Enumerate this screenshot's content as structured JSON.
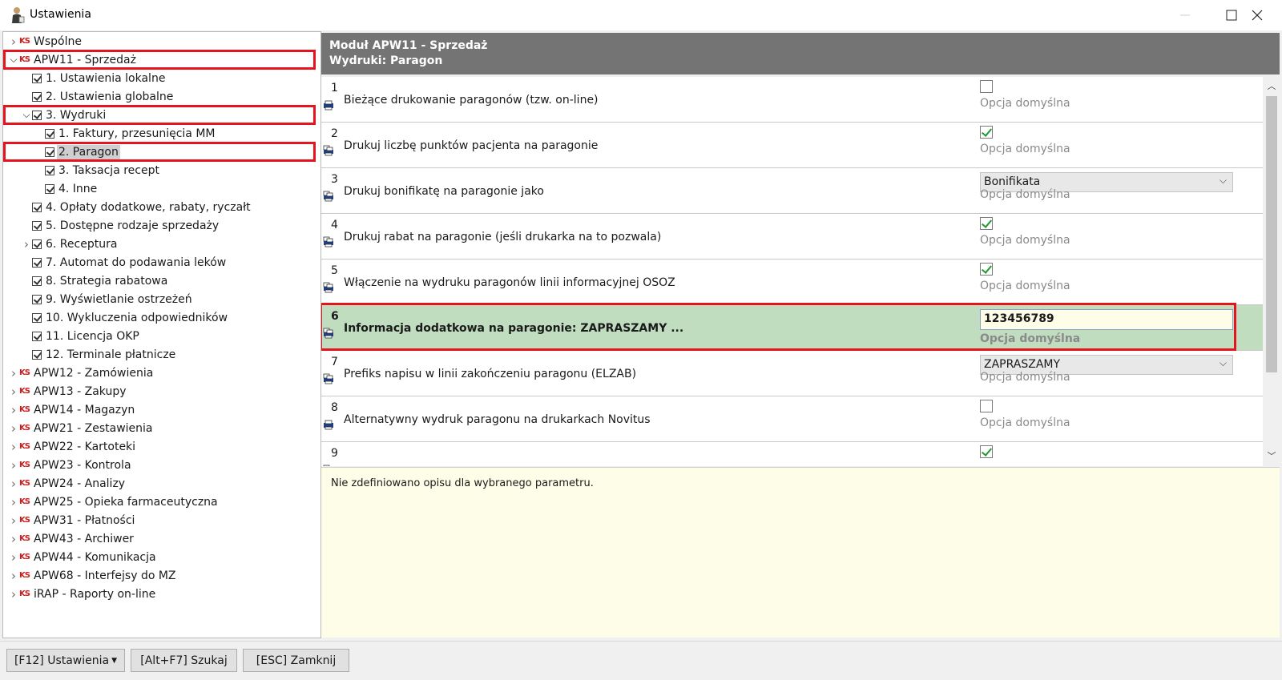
{
  "window": {
    "title": "Ustawienia"
  },
  "tree": [
    {
      "label": "Wspólne",
      "level": 0,
      "icon": "ks-icon",
      "expander": "chevron-right-icon"
    },
    {
      "label": "APW11 - Sprzedaż",
      "level": 0,
      "icon": "ks-icon",
      "expander": "chevron-down-icon",
      "highlight": true
    },
    {
      "label": "1. Ustawienia lokalne",
      "level": 1,
      "icon": "check-icon"
    },
    {
      "label": "2. Ustawienia globalne",
      "level": 1,
      "icon": "check-icon"
    },
    {
      "label": "3. Wydruki",
      "level": 1,
      "icon": "check-icon",
      "expander": "chevron-down-icon",
      "highlight": true
    },
    {
      "label": "1. Faktury, przesunięcia MM",
      "level": 2,
      "icon": "check-icon"
    },
    {
      "label": "2. Paragon",
      "level": 2,
      "icon": "check-icon",
      "selected": true,
      "highlight": true
    },
    {
      "label": "3. Taksacja recept",
      "level": 2,
      "icon": "check-icon"
    },
    {
      "label": "4. Inne",
      "level": 2,
      "icon": "check-icon"
    },
    {
      "label": "4. Opłaty dodatkowe, rabaty, ryczałt",
      "level": 1,
      "icon": "check-icon"
    },
    {
      "label": "5. Dostępne rodzaje sprzedaży",
      "level": 1,
      "icon": "check-icon"
    },
    {
      "label": "6. Receptura",
      "level": 1,
      "icon": "check-icon",
      "expander": "chevron-right-icon"
    },
    {
      "label": "7. Automat do podawania leków",
      "level": 1,
      "icon": "check-icon"
    },
    {
      "label": "8. Strategia rabatowa",
      "level": 1,
      "icon": "check-icon"
    },
    {
      "label": "9. Wyświetlanie ostrzeżeń",
      "level": 1,
      "icon": "check-icon"
    },
    {
      "label": "10. Wykluczenia odpowiedników",
      "level": 1,
      "icon": "check-icon"
    },
    {
      "label": "11. Licencja OKP",
      "level": 1,
      "icon": "check-icon"
    },
    {
      "label": "12. Terminale płatnicze",
      "level": 1,
      "icon": "check-icon"
    },
    {
      "label": "APW12 - Zamówienia",
      "level": 0,
      "icon": "ks-icon",
      "expander": "chevron-right-icon"
    },
    {
      "label": "APW13 - Zakupy",
      "level": 0,
      "icon": "ks-icon",
      "expander": "chevron-right-icon"
    },
    {
      "label": "APW14 - Magazyn",
      "level": 0,
      "icon": "ks-icon",
      "expander": "chevron-right-icon"
    },
    {
      "label": "APW21 - Zestawienia",
      "level": 0,
      "icon": "ks-icon",
      "expander": "chevron-right-icon"
    },
    {
      "label": "APW22 - Kartoteki",
      "level": 0,
      "icon": "ks-icon",
      "expander": "chevron-right-icon"
    },
    {
      "label": "APW23 - Kontrola",
      "level": 0,
      "icon": "ks-icon",
      "expander": "chevron-right-icon"
    },
    {
      "label": "APW24 - Analizy",
      "level": 0,
      "icon": "ks-icon",
      "expander": "chevron-right-icon"
    },
    {
      "label": "APW25 - Opieka farmaceutyczna",
      "level": 0,
      "icon": "ks-icon",
      "expander": "chevron-right-icon"
    },
    {
      "label": "APW31 - Płatności",
      "level": 0,
      "icon": "ks-icon",
      "expander": "chevron-right-icon"
    },
    {
      "label": "APW43 - Archiwer",
      "level": 0,
      "icon": "ks-icon",
      "expander": "chevron-right-icon"
    },
    {
      "label": "APW44 - Komunikacja",
      "level": 0,
      "icon": "ks-icon",
      "expander": "chevron-right-icon"
    },
    {
      "label": "APW68 - Interfejsy do MZ",
      "level": 0,
      "icon": "ks-icon",
      "expander": "chevron-right-icon"
    },
    {
      "label": "iRAP - Raporty on-line",
      "level": 0,
      "icon": "ks-icon",
      "expander": "chevron-right-icon"
    }
  ],
  "header": {
    "line1": "Moduł APW11 - Sprzedaż",
    "line2": "Wydruki: Paragon"
  },
  "params": [
    {
      "num": "1",
      "name": "Bieżące drukowanie paragonów (tzw. on-line)",
      "control": "checkbox",
      "checked": false,
      "default": "Opcja domyślna",
      "icon": "printer-icon"
    },
    {
      "num": "2",
      "name": "Drukuj liczbę punktów pacjenta na paragonie",
      "control": "checkbox",
      "checked": true,
      "default": "Opcja domyślna",
      "icon": "printer-multi-icon"
    },
    {
      "num": "3",
      "name": "Drukuj bonifikatę na paragonie jako",
      "control": "select",
      "value": "Bonifikata",
      "default": "Opcja domyślna",
      "icon": "printer-multi-icon"
    },
    {
      "num": "4",
      "name": "Drukuj rabat na paragonie (jeśli drukarka na to pozwala)",
      "control": "checkbox",
      "checked": true,
      "default": "Opcja domyślna",
      "icon": "printer-multi-icon"
    },
    {
      "num": "5",
      "name": "Włączenie na wydruku paragonów linii informacyjnej OSOZ",
      "control": "checkbox",
      "checked": true,
      "default": "Opcja domyślna",
      "icon": "printer-multi-icon"
    },
    {
      "num": "6",
      "name": "Informacja dodatkowa na paragonie: ZAPRASZAMY ...",
      "control": "text",
      "value": "123456789",
      "default": "Opcja domyślna",
      "icon": "printer-multi-icon",
      "active": true
    },
    {
      "num": "7",
      "name": "Prefiks napisu w linii zakończeniu paragonu (ELZAB)",
      "control": "select",
      "value": "ZAPRASZAMY",
      "default": "Opcja domyślna",
      "icon": "printer-multi-icon"
    },
    {
      "num": "8",
      "name": "Alternatywny wydruk paragonu na drukarkach Novitus",
      "control": "checkbox",
      "checked": false,
      "default": "Opcja domyślna",
      "icon": "printer-icon"
    },
    {
      "num": "9",
      "name": "",
      "control": "checkbox",
      "checked": true,
      "default": "",
      "icon": "printer-multi-icon"
    }
  ],
  "description": "Nie zdefiniowano opisu dla wybranego parametru.",
  "footer": {
    "settings_label": "[F12] Ustawienia",
    "search_label": "[Alt+F7] Szukaj",
    "close_label": "[ESC] Zamknij"
  },
  "colors": {
    "highlight": "#e3151f",
    "active_row": "#c0ddc0",
    "header": "#747474",
    "description_bg": "#fefde8"
  }
}
